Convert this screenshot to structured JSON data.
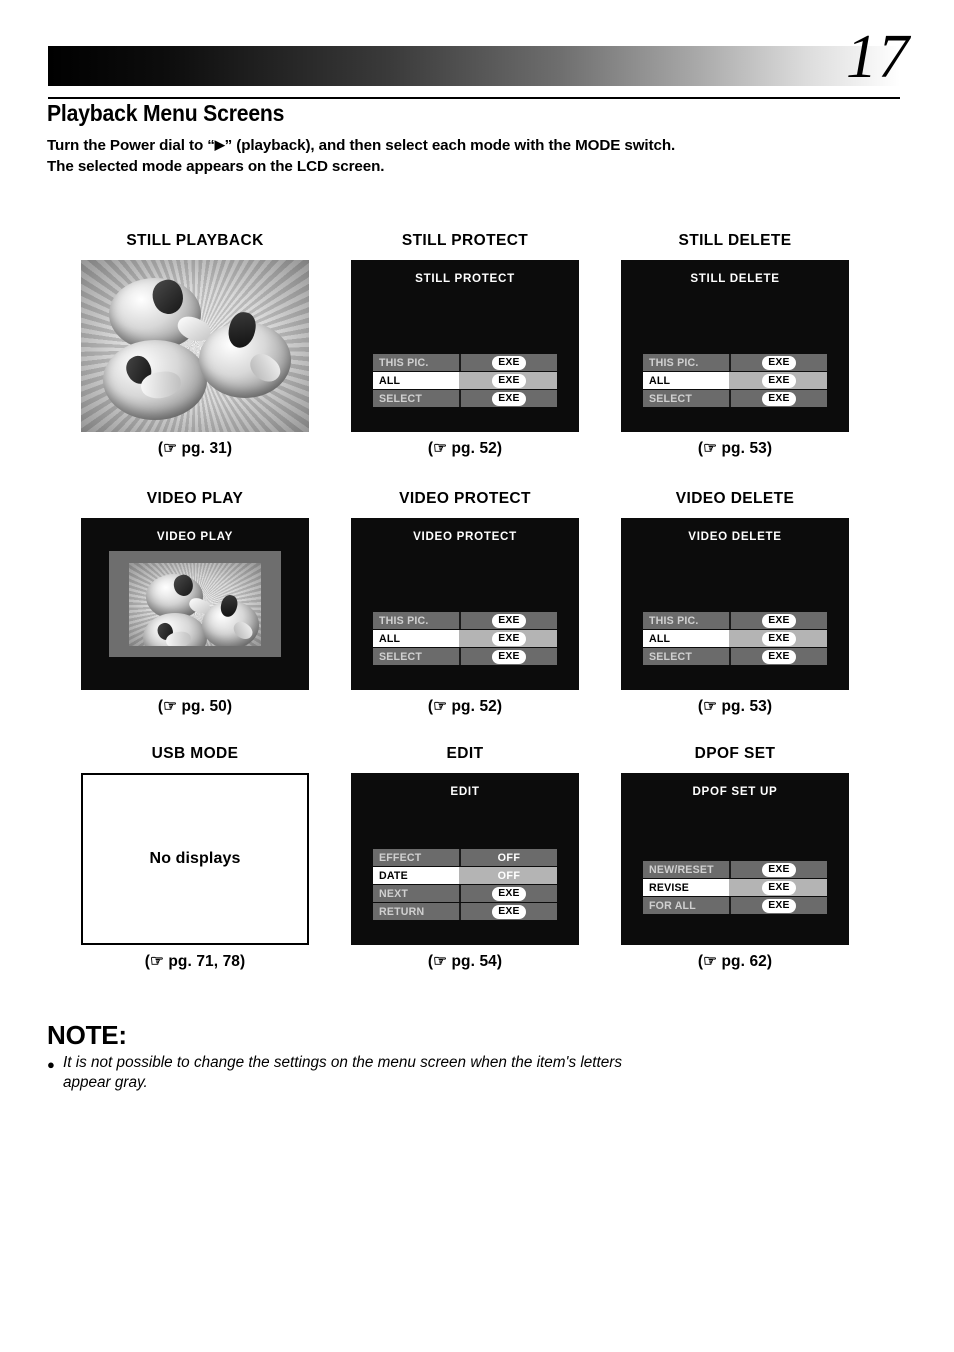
{
  "header": {
    "page_number": "17",
    "section_title": "Playback Menu Screens",
    "intro_line1_a": "Turn the Power dial to “",
    "intro_play_icon": "▶",
    "intro_line1_b": "” (playback), and then select each mode with the MODE switch.",
    "intro_line2": "The selected mode appears on the LCD screen."
  },
  "hand_icon": "☞",
  "panels": [
    {
      "title": "STILL PLAYBACK",
      "kind": "photo",
      "screen_title": "",
      "caption": "(☞ pg. 31)",
      "page_ref": "pg. 31",
      "rows": []
    },
    {
      "title": "STILL PROTECT",
      "kind": "menu",
      "screen_title": "STILL PROTECT",
      "menu_position": "low",
      "caption": "(☞ pg. 52)",
      "page_ref": "pg. 52",
      "rows": [
        {
          "label": "THIS PIC.",
          "value": "EXE",
          "value_type": "exe",
          "selected": false
        },
        {
          "label": "ALL",
          "value": "EXE",
          "value_type": "exe",
          "selected": true
        },
        {
          "label": "SELECT",
          "value": "EXE",
          "value_type": "exe",
          "selected": false
        }
      ]
    },
    {
      "title": "STILL DELETE",
      "kind": "menu",
      "screen_title": "STILL DELETE",
      "menu_position": "low",
      "caption": "(☞ pg. 53)",
      "page_ref": "pg. 53",
      "rows": [
        {
          "label": "THIS PIC.",
          "value": "EXE",
          "value_type": "exe",
          "selected": false
        },
        {
          "label": "ALL",
          "value": "EXE",
          "value_type": "exe",
          "selected": true
        },
        {
          "label": "SELECT",
          "value": "EXE",
          "value_type": "exe",
          "selected": false
        }
      ]
    },
    {
      "title": "VIDEO PLAY",
      "kind": "video",
      "screen_title": "VIDEO PLAY",
      "caption": "(☞ pg. 50)",
      "page_ref": "pg. 50",
      "rows": []
    },
    {
      "title": "VIDEO PROTECT",
      "kind": "menu",
      "screen_title": "VIDEO PROTECT",
      "menu_position": "low",
      "caption": "(☞ pg. 52)",
      "page_ref": "pg. 52",
      "rows": [
        {
          "label": "THIS PIC.",
          "value": "EXE",
          "value_type": "exe",
          "selected": false
        },
        {
          "label": "ALL",
          "value": "EXE",
          "value_type": "exe",
          "selected": true
        },
        {
          "label": "SELECT",
          "value": "EXE",
          "value_type": "exe",
          "selected": false
        }
      ]
    },
    {
      "title": "VIDEO DELETE",
      "kind": "menu",
      "screen_title": "VIDEO DELETE",
      "menu_position": "low",
      "caption": "(☞ pg. 53)",
      "page_ref": "pg. 53",
      "rows": [
        {
          "label": "THIS PIC.",
          "value": "EXE",
          "value_type": "exe",
          "selected": false
        },
        {
          "label": "ALL",
          "value": "EXE",
          "value_type": "exe",
          "selected": true
        },
        {
          "label": "SELECT",
          "value": "EXE",
          "value_type": "exe",
          "selected": false
        }
      ]
    },
    {
      "title": "USB MODE",
      "kind": "blank",
      "screen_title": "",
      "blank_text": "No displays",
      "caption": "(☞ pg. 71, 78)",
      "page_ref": "pg. 71, 78",
      "rows": []
    },
    {
      "title": "EDIT",
      "kind": "menu",
      "screen_title": "EDIT",
      "menu_position": "low",
      "caption": "(☞ pg. 54)",
      "page_ref": "pg. 54",
      "rows": [
        {
          "label": "EFFECT",
          "value": "OFF",
          "value_type": "plain",
          "selected": false
        },
        {
          "label": "DATE",
          "value": "OFF",
          "value_type": "plain",
          "selected": true
        },
        {
          "label": "NEXT",
          "value": "EXE",
          "value_type": "exe",
          "selected": false
        },
        {
          "label": "RETURN",
          "value": "EXE",
          "value_type": "exe",
          "selected": false
        }
      ]
    },
    {
      "title": "DPOF SET",
      "kind": "menu",
      "screen_title": "DPOF SET UP",
      "menu_position": "high",
      "caption": "(☞ pg. 62)",
      "page_ref": "pg. 62",
      "rows": [
        {
          "label": "NEW/RESET",
          "value": "EXE",
          "value_type": "exe",
          "selected": false
        },
        {
          "label": "REVISE",
          "value": "EXE",
          "value_type": "exe",
          "selected": true
        },
        {
          "label": "FOR ALL",
          "value": "EXE",
          "value_type": "exe",
          "selected": false
        }
      ]
    }
  ],
  "note": {
    "heading": "NOTE:",
    "bullet": "●",
    "text": "It is not possible to change the settings on the menu screen when the item's letters appear gray."
  },
  "colors": {
    "screen_bg": "#0c0c0c",
    "row_bg": "#6b6b6b",
    "row_selected_label_bg": "#ffffff",
    "row_selected_value_bg": "#b4b4b4",
    "exe_bg": "#ffffff",
    "page_text": "#000000"
  }
}
